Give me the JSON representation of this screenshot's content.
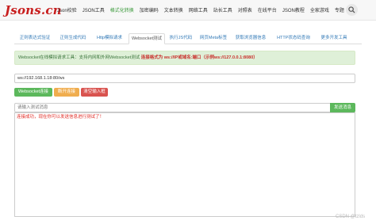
{
  "header": {
    "logo": "Jsons.cn",
    "nav": [
      "Json校验",
      "JSON工具",
      "格式化转换",
      "加密编码",
      "文本转换",
      "网络工具",
      "站长工具",
      "对照表",
      "在线平台",
      "JSON教程",
      "全家游戏",
      "专题"
    ],
    "active_nav_index": 2
  },
  "tabs": {
    "items": [
      "正则表达式验证",
      "正则生成代码",
      "Http模拟请求",
      "Websocket测试",
      "执行JS代码",
      "网页Meta标签",
      "获取浏览器信息",
      "HTTP状态码查询",
      "更多开发工具"
    ],
    "active_index": 3
  },
  "alert": {
    "text": "Websocket在线模拟请求工具：支持内网和外网Websocket测试",
    "highlight": "连接格式为 ws://IP或域名:端口（示例ws://127.0.0.1:8080）"
  },
  "address": {
    "value": "ws://192.168.1.18:80/ws"
  },
  "buttons": {
    "connect": "Websocket连接",
    "disconnect": "断开连接",
    "clear": "清空输入框"
  },
  "message": {
    "placeholder": "请输入测试消息",
    "send": "发送消息"
  },
  "output": {
    "lines": [
      "连接成功，现在你可以发送信息进行测试了！"
    ]
  },
  "watermark": "CSDN @tzlds",
  "colors": {
    "accent": "#5cb85c",
    "warn": "#f0ad4e",
    "danger": "#d9534f",
    "error_text": "#e0261f",
    "brand": "#c81e1e"
  }
}
